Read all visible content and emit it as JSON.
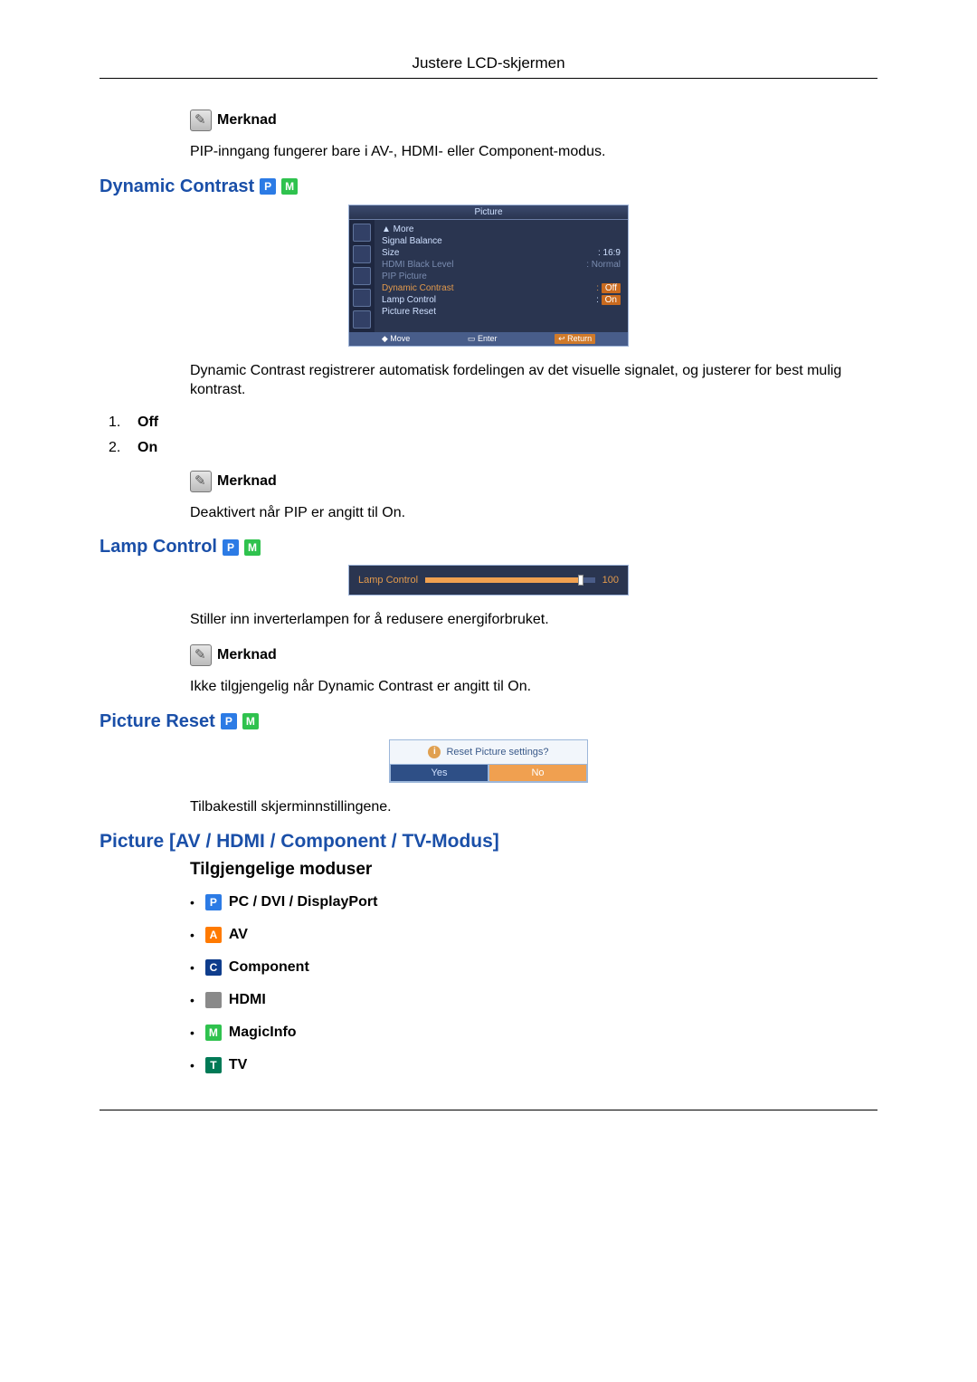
{
  "header": {
    "title": "Justere LCD-skjermen"
  },
  "note_label": "Merknad",
  "notes": {
    "pip_input": "PIP-inngang fungerer bare i AV-, HDMI- eller Component-modus.",
    "pip_on": "Deaktivert når PIP er angitt til On.",
    "dc_on": "Ikke tilgjengelig når Dynamic Contrast er angitt til On."
  },
  "sections": {
    "dynamic_contrast": {
      "title": "Dynamic Contrast",
      "desc": "Dynamic Contrast registrerer automatisk fordelingen av det visuelle signalet, og justerer for best mulig kontrast.",
      "options": {
        "off": "Off",
        "on": "On"
      }
    },
    "lamp_control": {
      "title": "Lamp Control",
      "desc": "Stiller inn inverterlampen for å redusere energiforbruket."
    },
    "picture_reset": {
      "title": "Picture Reset",
      "desc": "Tilbakestill skjerminnstillingene."
    },
    "picture_modes": {
      "title": "Picture [AV / HDMI / Component / TV-Modus]",
      "subheading": "Tilgjengelige moduser",
      "modes": {
        "pc": "PC / DVI / DisplayPort",
        "av": "AV",
        "component": "Component",
        "hdmi": "HDMI",
        "magicinfo": "MagicInfo",
        "tv": "TV"
      }
    }
  },
  "osd": {
    "picture": {
      "title": "Picture",
      "more": "▲ More",
      "rows": {
        "signal_balance": "Signal Balance",
        "size": "Size",
        "size_val": "16:9",
        "hdmi_black": "HDMI Black Level",
        "hdmi_black_val": "Normal",
        "pip_picture": "PIP Picture",
        "dynamic_contrast": "Dynamic Contrast",
        "dynamic_contrast_val": "Off",
        "lamp_control": "Lamp Control",
        "lamp_control_val": "On",
        "picture_reset": "Picture Reset"
      },
      "footer": {
        "move": "Move",
        "enter": "Enter",
        "return": "Return"
      }
    },
    "lamp": {
      "label": "Lamp Control",
      "value": "100"
    },
    "reset": {
      "question": "Reset Picture settings?",
      "yes": "Yes",
      "no": "No"
    }
  },
  "chart_data": {
    "type": "table",
    "title": "Picture OSD menu values",
    "rows": [
      {
        "label": "Signal Balance",
        "value": ""
      },
      {
        "label": "Size",
        "value": "16:9"
      },
      {
        "label": "HDMI Black Level",
        "value": "Normal"
      },
      {
        "label": "PIP Picture",
        "value": ""
      },
      {
        "label": "Dynamic Contrast",
        "value": "Off"
      },
      {
        "label": "Lamp Control",
        "value": "On"
      },
      {
        "label": "Picture Reset",
        "value": ""
      }
    ],
    "lamp_control_slider": 100
  }
}
